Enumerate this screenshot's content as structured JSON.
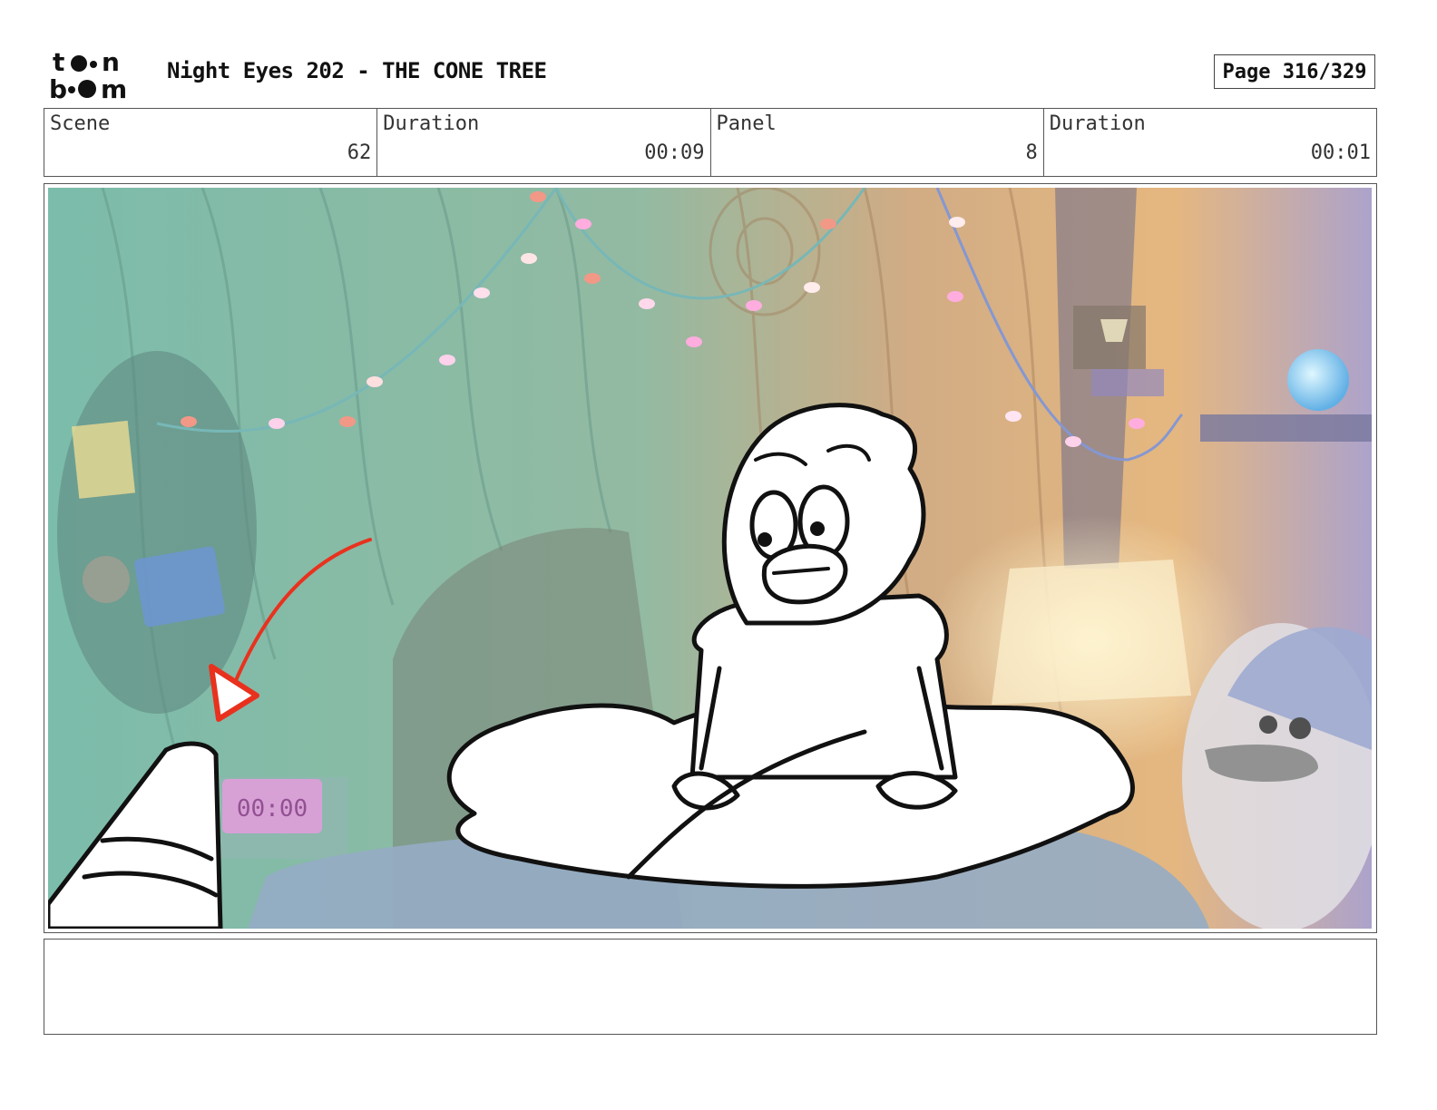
{
  "header": {
    "logo_line1": "toon",
    "logo_line2": "boom",
    "title": "Night Eyes 202 - THE CONE TREE",
    "page_label": "Page 316/329"
  },
  "info": {
    "scene_label": "Scene",
    "scene_value": "62",
    "scene_duration_label": "Duration",
    "scene_duration_value": "00:09",
    "panel_label": "Panel",
    "panel_value": "8",
    "panel_duration_label": "Duration",
    "panel_duration_value": "00:01"
  },
  "panel": {
    "clock_display": "00:00",
    "colors": {
      "arrow": "#e8321e",
      "left_wall": "#5fae98",
      "right_wall": "#d89a5a",
      "bed": "#7e9ab8",
      "lamp_orb": "#7fd4ff",
      "clock": "#d98ad4"
    }
  },
  "notes": {
    "text": ""
  }
}
